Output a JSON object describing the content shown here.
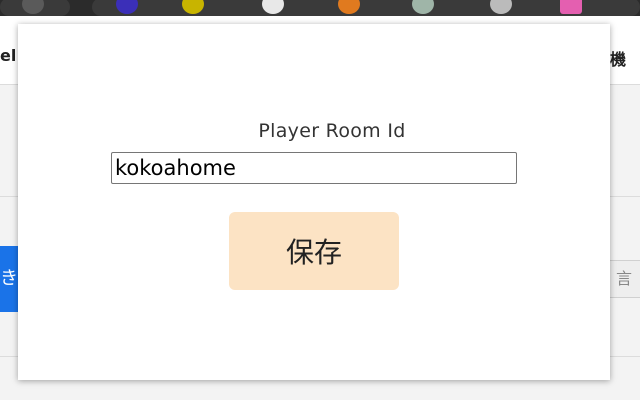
{
  "popup": {
    "field_label": "Player Room Id",
    "room_id_value": "kokoahome",
    "save_label": "保存"
  },
  "background_page": {
    "left_side_text": "el",
    "right_side_text": "機",
    "left_button_text": "き",
    "right_button_text": "言"
  },
  "toolbar_icons": [
    {
      "name": "bookmark-icon",
      "color": "#5a5a5a"
    },
    {
      "name": "hexagon-extension-icon",
      "color": "#3b2fb8"
    },
    {
      "name": "triangle-extension-icon",
      "color": "#c8b400"
    },
    {
      "name": "person-extension-icon",
      "color": "#e8e8e8"
    },
    {
      "name": "fox-extension-icon",
      "color": "#e07a1f"
    },
    {
      "name": "face-extension-icon",
      "color": "#9fb5a8"
    },
    {
      "name": "pin-extension-icon",
      "color": "#bbbbbb"
    },
    {
      "name": "pink-extension-icon",
      "color": "#e45fb0"
    }
  ],
  "colors": {
    "save_button_bg": "#fce3c4",
    "page_background": "#f3f3f3",
    "accent_blue": "#1a73e8"
  }
}
